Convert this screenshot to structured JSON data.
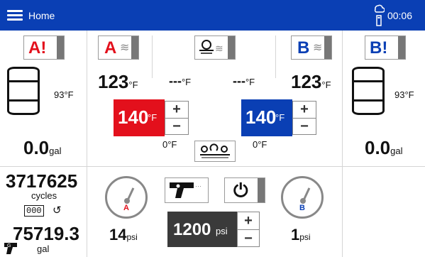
{
  "header": {
    "title": "Home",
    "time": "00:06"
  },
  "colors": {
    "primary": "#0a3fb4",
    "side_a": "#e3101c",
    "side_b": "#0a3fb4",
    "muted": "#888888"
  },
  "tank_a": {
    "alert_label": "A!",
    "temp": "93",
    "temp_unit": "°F",
    "volume": "0.0",
    "volume_unit": "gal"
  },
  "tank_b": {
    "alert_label": "B!",
    "temp": "93",
    "temp_unit": "°F",
    "volume": "0.0",
    "volume_unit": "gal"
  },
  "heater_a": {
    "label": "A",
    "actual": "123",
    "unit": "°F",
    "setpoint": "140",
    "setpoint_unit": "°F",
    "low": "0°F"
  },
  "hose": {
    "temp_a": "---",
    "temp_b": "---",
    "unit": "°F"
  },
  "heater_b": {
    "label": "B",
    "actual": "123",
    "unit": "°F",
    "setpoint": "140",
    "setpoint_unit": "°F",
    "low": "0°F"
  },
  "counters": {
    "cycles": "3717625",
    "cycles_label": "cycles",
    "reset_counter": "000",
    "gallons": "75719.3",
    "gallons_label": "gal"
  },
  "pressure": {
    "a_label": "A",
    "a_value": "14",
    "b_label": "B",
    "b_value": "1",
    "unit": "psi",
    "setpoint": "1200",
    "setpoint_unit": "psi"
  },
  "stepper": {
    "plus": "+",
    "minus": "−"
  }
}
